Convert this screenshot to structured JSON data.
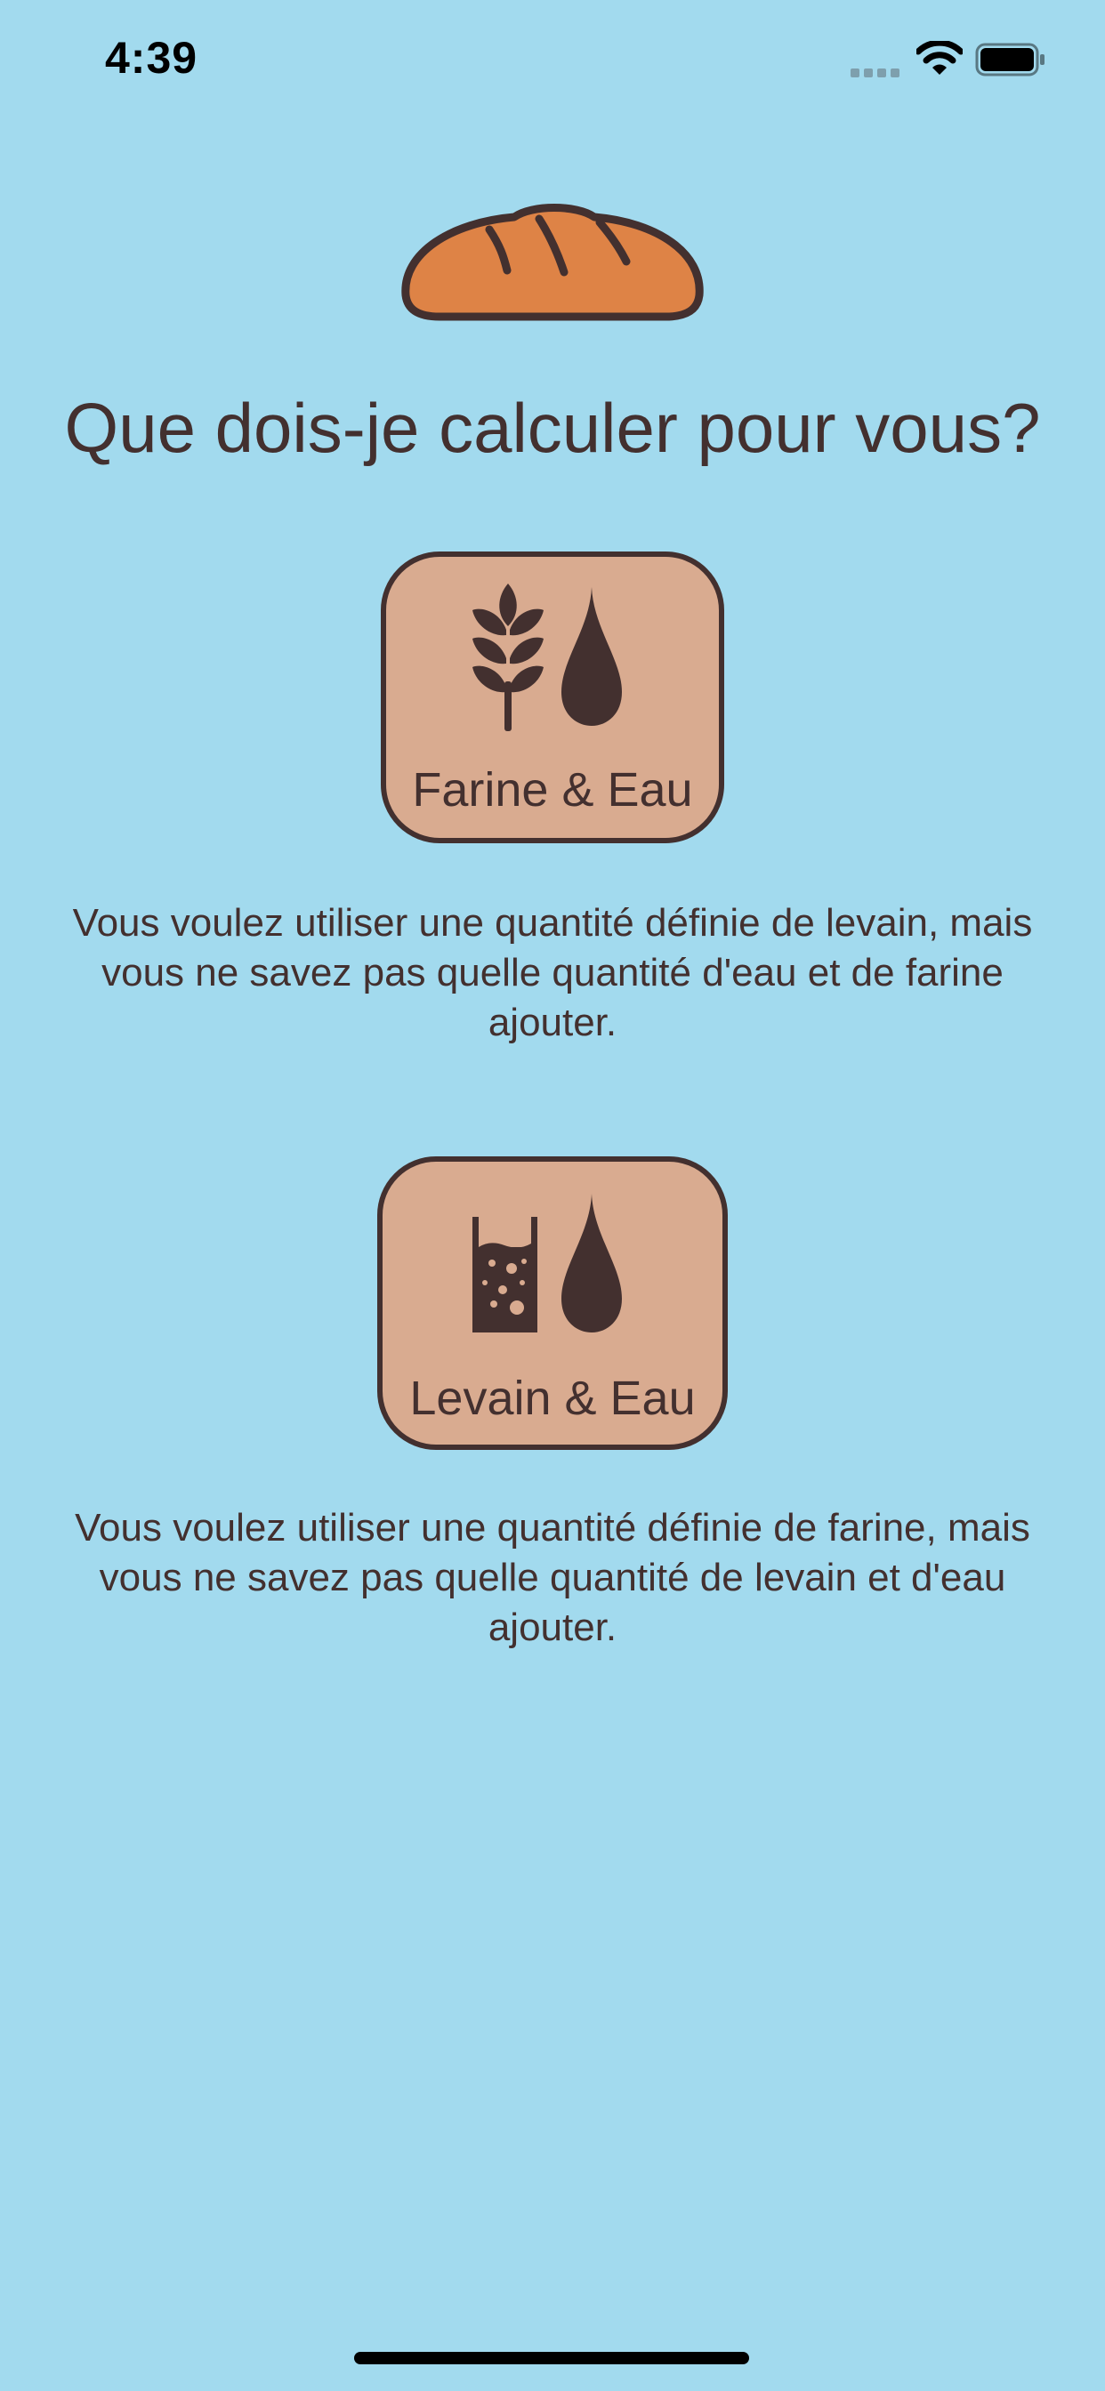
{
  "status_bar": {
    "time": "4:39",
    "signal_icon": "cellular-signal-icon",
    "wifi_icon": "wifi-icon",
    "battery_icon": "battery-icon"
  },
  "header": {
    "logo_icon": "bread-icon",
    "title": "Que dois-je calculer pour vous?"
  },
  "options": [
    {
      "label": "Farine & Eau",
      "icons": [
        "wheat-icon",
        "water-drop-icon"
      ],
      "description": "Vous voulez utiliser une quantité définie de levain, mais vous ne savez pas quelle quantité d'eau et de farine ajouter."
    },
    {
      "label": "Levain & Eau",
      "icons": [
        "levain-jar-icon",
        "water-drop-icon"
      ],
      "description": "Vous voulez utiliser une quantité définie de farine, mais vous ne savez pas quelle quantité de levain et d'eau ajouter."
    }
  ],
  "colors": {
    "background": "#a2daee",
    "button_fill": "#d9ab90",
    "dark_brown": "#43302f",
    "bread_orange": "#de8346"
  }
}
